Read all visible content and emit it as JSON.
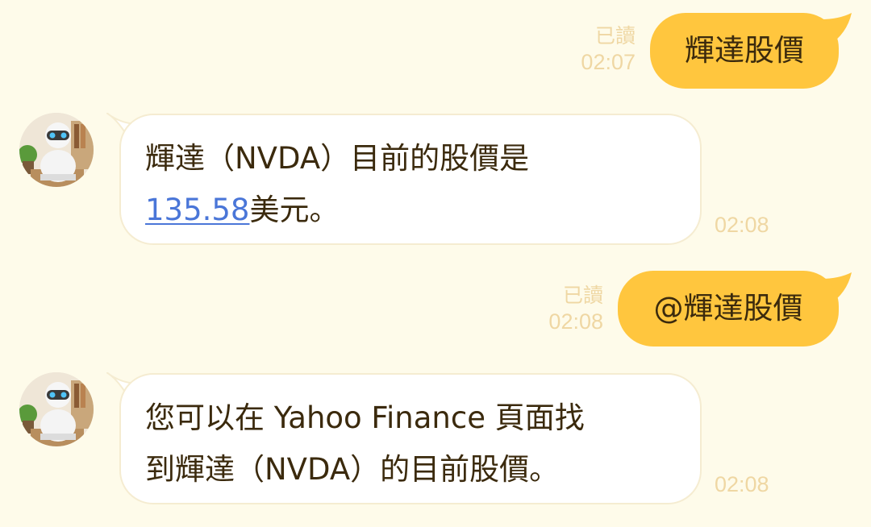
{
  "messages": [
    {
      "sender": "user",
      "text": "輝達股價",
      "read_label": "已讀",
      "time": "02:07"
    },
    {
      "sender": "bot",
      "line1": "輝達（NVDA）目前的股價是",
      "price_link": "135.58",
      "suffix": "美元。",
      "time": "02:08"
    },
    {
      "sender": "user",
      "text": "@輝達股價",
      "read_label": "已讀",
      "time": "02:08"
    },
    {
      "sender": "bot",
      "line1": "您可以在 Yahoo Finance 頁面找",
      "line2": "到輝達（NVDA）的目前股價。",
      "time": "02:08"
    }
  ],
  "colors": {
    "background": "#fefbea",
    "outgoing_bubble": "#ffc63e",
    "incoming_bubble": "#ffffff",
    "meta_text": "#efd7a3",
    "message_text": "#3b2a0d",
    "link": "#4a76d8"
  },
  "icons": {
    "avatar": "robot-avatar"
  }
}
